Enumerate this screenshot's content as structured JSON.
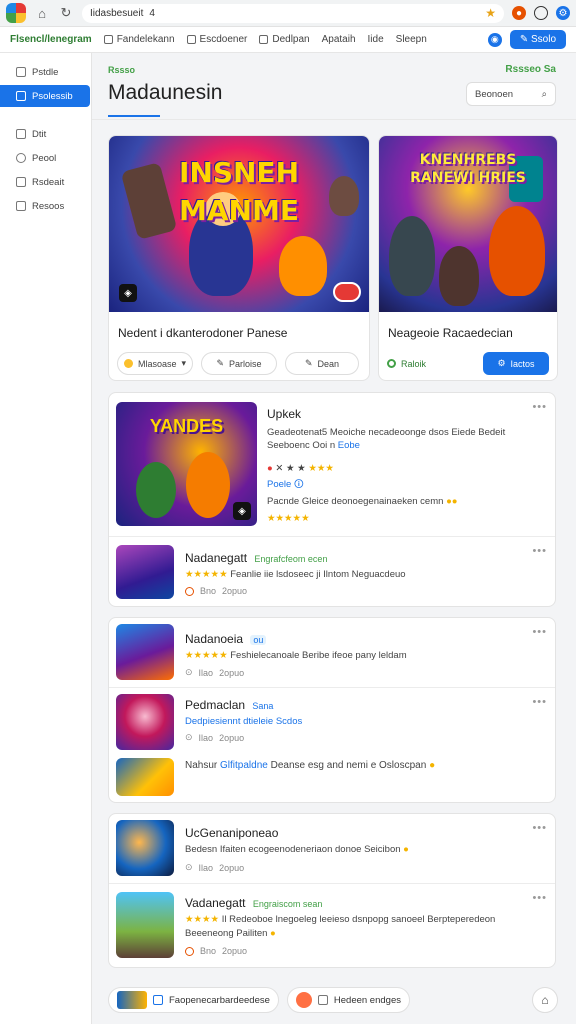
{
  "browser": {
    "address": "Iidasbesueit",
    "address_extra": "4"
  },
  "bookmarks": {
    "items": [
      "Flsencl/lenegram",
      "Fandelekann",
      "Escdoener",
      "Dedlpan",
      "Apataih",
      "Iide",
      "Sleepn"
    ],
    "action_label": "Ssolo"
  },
  "sidebar": {
    "items": [
      "Pstdle",
      "Psolessib",
      "Dtit",
      "Peool",
      "Rsdeait",
      "Resoos"
    ]
  },
  "header": {
    "tag": "Rssso",
    "right_label": "Rssseo Sa",
    "title": "Madaunesin",
    "search_label": "Beonoen"
  },
  "featured": [
    {
      "art_title": "INSNEH\nMANME",
      "title": "Nedent i dkanterodoner Panese",
      "actions": [
        "Mlasoase",
        "Parloise",
        "Dean"
      ]
    },
    {
      "art_title": "KNENHREBS\nRANEWI HRIES",
      "title": "Neageoie Racaedecian",
      "actions": [
        "Raloik",
        "Iactos"
      ]
    }
  ],
  "list1": [
    {
      "title": "Upkek",
      "art_title": "YANDES",
      "lines": [
        "Geadeotenat5 Meoiche necadeoonge dsos Eiede Bedeit",
        "Seeboenc Ooi n",
        "Pacnde Gleice deonoegenainaeken cemn"
      ],
      "link": "Poele",
      "link2": "Eobe"
    },
    {
      "title": "Nadanegatt",
      "tag": "Engrafcfeom ecen",
      "line": "Feanlie iie lsdoseec ji Ilntom Neguacdeuo",
      "meta": [
        "Bno",
        "2opuo"
      ]
    }
  ],
  "list2": [
    {
      "title": "Nadanoeia",
      "tag": "ou",
      "line": "Feshielecanoale Beribe ifeoe pany leldam",
      "meta": [
        "Ilao",
        "2opuo"
      ]
    },
    {
      "title": "Pedmaclan",
      "tag": "Sana",
      "line": "Dedpiesiennt dtieleie Scdos",
      "meta": [
        "Ilao",
        "2opuo"
      ]
    },
    {
      "title": "Nahsur",
      "tag": "Glfitpaldne",
      "line": "Deanse esg and nemi e Osloscpan"
    }
  ],
  "list3": [
    {
      "title": "UcGenaniponeao",
      "line": "Bedesn Ifaiten ecogeenodeneriaon donoe Seicibon",
      "meta": [
        "Ilao",
        "2opuo"
      ]
    },
    {
      "title": "Vadanegatt",
      "tag": "Engraiscom sean",
      "line": "Il Redeoboe lnegoeleg leeieso dsnpopg sanoeel Berpteperedeon",
      "line2": "Beeeneong Pailiten",
      "meta": [
        "Bno",
        "2opuo"
      ]
    }
  ],
  "bottom": {
    "pill1": "Faopenecarbardeedese",
    "pill2": "Hedeen endges"
  },
  "colors": {
    "accent": "#1a73e8",
    "green": "#43a047",
    "star": "#f4b400"
  }
}
